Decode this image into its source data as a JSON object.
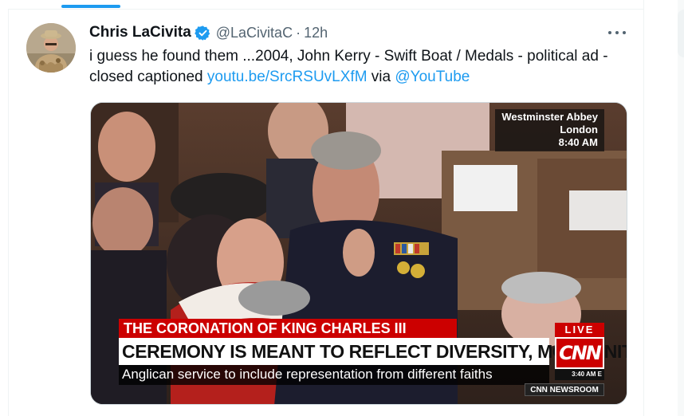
{
  "nav": {
    "active_tab_color": "#1d9bf0"
  },
  "tweet": {
    "author": {
      "display_name": "Chris LaCivita",
      "handle": "@LaCivitaC",
      "verified": true,
      "avatar_icon": "avatar-photo"
    },
    "separator": "·",
    "time": "12h",
    "more_icon": "ellipsis-icon",
    "text_prefix": "i guess he found them ...2004, John Kerry - Swift Boat / Medals - political ad - closed captioned ",
    "link_text": "youtu.be/SrcRSUvLXfM",
    "text_mid": " via ",
    "mention_text": "@YouTube",
    "colors": {
      "link": "#1d9bf0",
      "text": "#0f1419",
      "secondary": "#536471",
      "verified": "#1d9bf0"
    }
  },
  "media": {
    "location_lines": [
      "Westminster Abbey",
      "London",
      "8:40 AM"
    ],
    "banner_title": "THE CORONATION OF KING CHARLES III",
    "banner_headline": "CEREMONY IS MEANT TO REFLECT DIVERSITY, MODERNITY",
    "banner_subline": "Anglican service to include representation from different faiths",
    "live_label": "LIVE",
    "network_logo": "CNN",
    "clock": "3:40 AM E",
    "program_label": "CNN NEWSROOM",
    "colors": {
      "network_red": "#cc0000"
    }
  }
}
